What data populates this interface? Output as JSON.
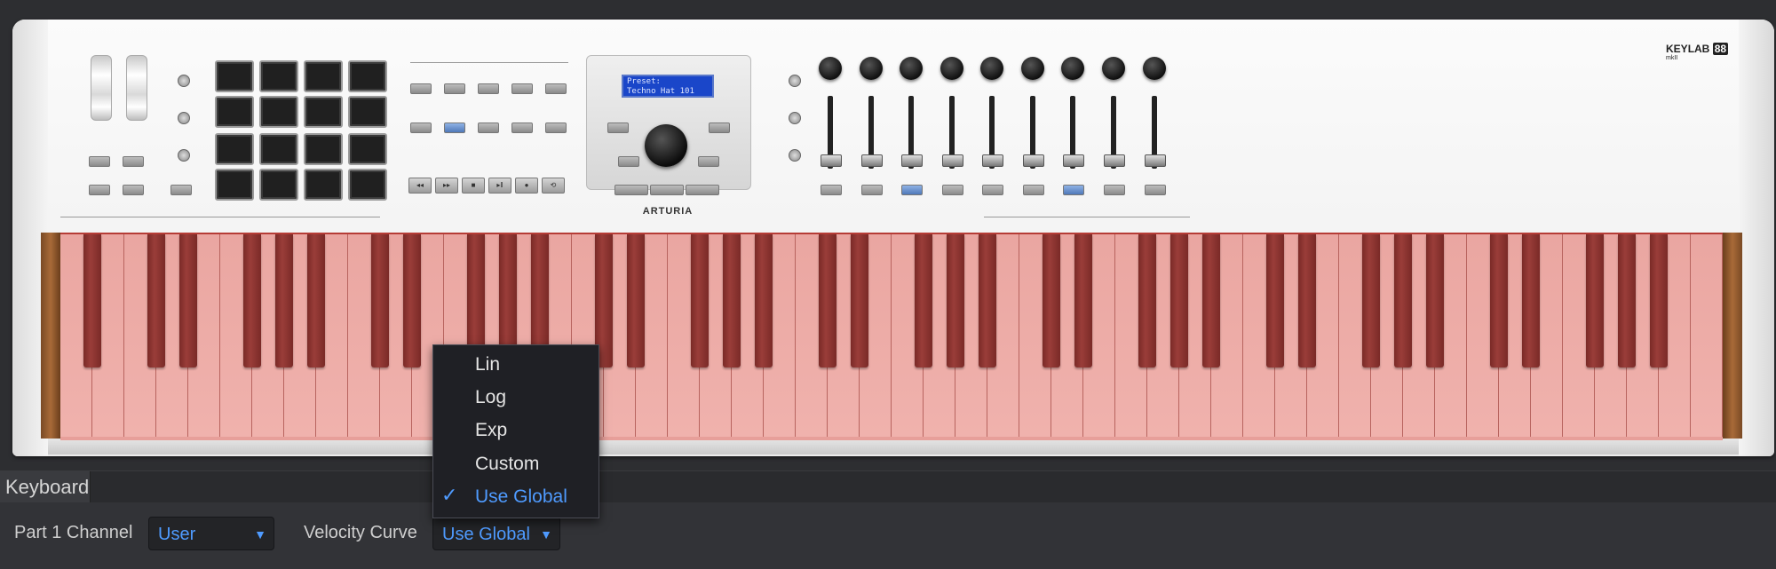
{
  "device": {
    "model_prefix": "KEY",
    "model_mid": "LAB",
    "model_badge": "88",
    "model_sub": "mkII",
    "brand": "ARTURIA",
    "lcd_line1": "Preset:",
    "lcd_line2": "Techno Hat 101"
  },
  "panel": {
    "tab_label": "Keyboard",
    "part1_channel_label": "Part 1 Channel",
    "part1_channel_value": "User",
    "velocity_curve_label": "Velocity Curve",
    "velocity_curve_value": "Use Global"
  },
  "velocity_menu": {
    "options": [
      "Lin",
      "Log",
      "Exp",
      "Custom",
      "Use Global"
    ],
    "selected": "Use Global"
  },
  "colors": {
    "accent": "#4f9bff",
    "keys_highlight": "#e79f9a",
    "black_keys": "#8a3431"
  }
}
